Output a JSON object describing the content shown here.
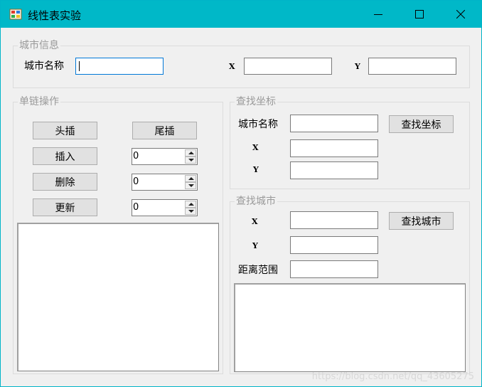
{
  "window": {
    "title": "线性表实验",
    "controls": {
      "minimize": "minimize-icon",
      "maximize": "maximize-icon",
      "close": "close-icon"
    }
  },
  "city_info": {
    "legend": "城市信息",
    "name_label": "城市名称",
    "name_value": "",
    "x_label": "X",
    "x_value": "",
    "y_label": "Y",
    "y_value": ""
  },
  "linked_list": {
    "legend": "单链操作",
    "head_insert": "头插",
    "tail_insert": "尾插",
    "insert": "插入",
    "insert_index": "0",
    "delete": "删除",
    "delete_index": "0",
    "update": "更新",
    "update_index": "0"
  },
  "find_coord": {
    "legend": "查找坐标",
    "name_label": "城市名称",
    "name_value": "",
    "button": "查找坐标",
    "x_label": "X",
    "x_value": "",
    "y_label": "Y",
    "y_value": ""
  },
  "find_city": {
    "legend": "查找城市",
    "x_label": "X",
    "x_value": "",
    "button": "查找城市",
    "y_label": "Y",
    "y_value": "",
    "range_label": "距离范围",
    "range_value": ""
  },
  "watermark": "https://blog.csdn.net/qq_43605275",
  "colors": {
    "titlebar": "#00b8c8",
    "window_bg": "#f0f0f0",
    "focus_border": "#0078d7"
  }
}
